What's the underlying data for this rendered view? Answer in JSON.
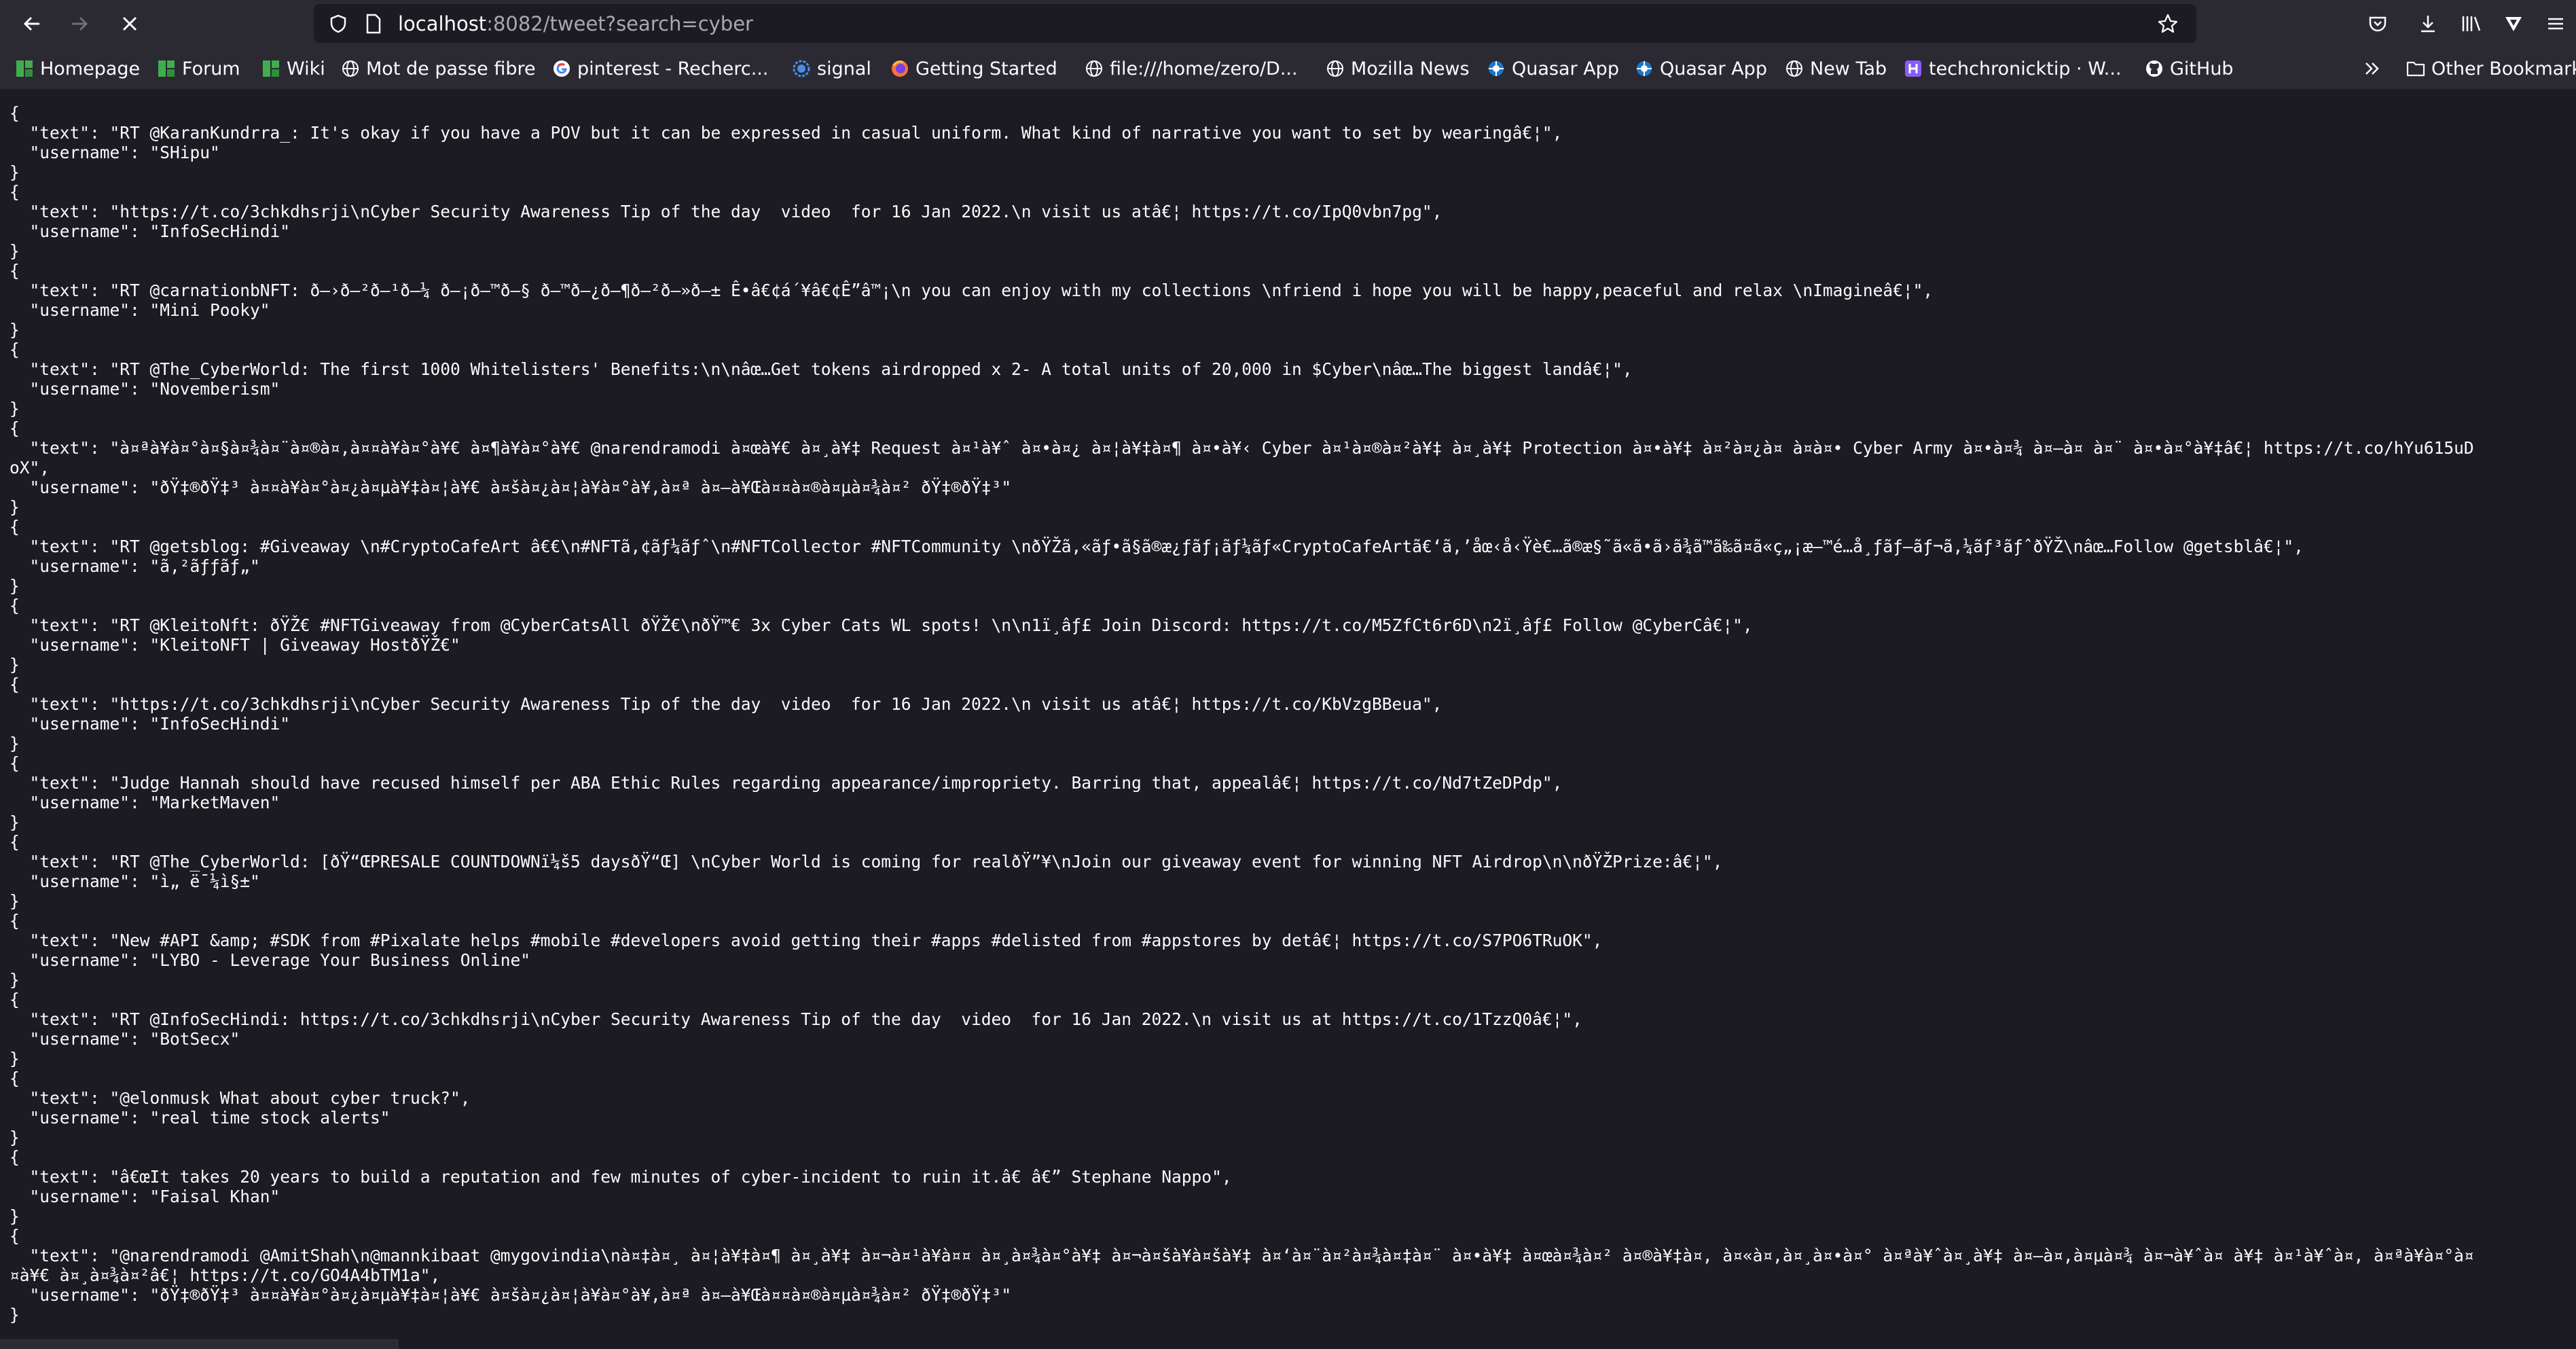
{
  "url": {
    "host": "localhost",
    "rest": ":8082/tweet?search=cyber"
  },
  "bookmarks": [
    {
      "label": "Homepage",
      "icon": "green-grid-icon"
    },
    {
      "label": "Forum",
      "icon": "green-grid-icon"
    },
    {
      "label": "Wiki",
      "icon": "green-grid-icon"
    },
    {
      "label": "Mot de passe fibre",
      "icon": "globe-icon"
    },
    {
      "label": "pinterest - Recherc...",
      "icon": "google-icon"
    },
    {
      "label": "signal",
      "icon": "signal-icon"
    },
    {
      "label": "Getting Started",
      "icon": "firefox-icon"
    },
    {
      "label": "file:///home/zero/D...",
      "icon": "globe-icon"
    },
    {
      "label": "Mozilla News",
      "icon": "globe-icon"
    },
    {
      "label": "Quasar App",
      "icon": "quasar-icon"
    },
    {
      "label": "Quasar App",
      "icon": "quasar-icon"
    },
    {
      "label": "New Tab",
      "icon": "globe-icon"
    },
    {
      "label": "techchronicktip · W...",
      "icon": "h-icon"
    },
    {
      "label": "GitHub",
      "icon": "github-icon"
    },
    {
      "label": "Other Bookmarks",
      "icon": "folder-icon"
    }
  ],
  "tweets": [
    {
      "text": "RT @KaranKundrra_: It's okay if you have a POV but it can be expressed in casual uniform. What kind of narrative you want to set by wearingâ€¦",
      "username": "SHipu"
    },
    {
      "text": "https://t.co/3chkdhsrji\\nCyber Security Awareness Tip of the day  video  for 16 Jan 2022.\\n visit us atâ€¦ https://t.co/IpQ0vbn7pg",
      "username": "InfoSecHindi"
    },
    {
      "text": "RT @carnationbNFT: ð–›ð–²ð–¹ð–¼ ð–¡ð–™ð–§ ð–™ð–¿ð–¶ð–²ð–»ð–± Ê•â€¢á´¥â€¢Ê”â™¡\\n you can enjoy with my collections \\nfriend i hope you will be happy,peaceful and relax \\nImagineâ€¦",
      "username": "Mini Pooky"
    },
    {
      "text": "RT @The_CyberWorld: The first 1000 Whitelisters' Benefits:\\n\\nâœ…Get tokens airdropped x 2- A total units of 20,000 in $Cyber\\nâœ…The biggest landâ€¦",
      "username": "Novemberism"
    },
    {
      "text": "à¤ªà¥à¤°à¤§à¤¾à¤¨à¤®à¤‚à¤¤à¥à¤°à¥€ à¤¶à¥à¤°à¥€ @narendramodi à¤œà¥€ à¤¸à¥‡ Request à¤¹à¥ˆ à¤•à¤¿ à¤¦à¥‡à¤¶ à¤•à¥‹ Cyber à¤¹à¤®à¤²à¥‡ à¤¸à¥‡ Protection à¤•à¥‡ à¤²à¤¿à¤ à¤à¤• Cyber Army à¤•à¤¾ à¤—à¤ à¤¨ à¤•à¤°à¥‡â€¦ https://t.co/hYu615uDoX",
      "username": "ðŸ‡®ðŸ‡³ à¤¤à¥à¤°à¤¿à¤µà¥‡à¤¦à¥€ à¤šà¤¿à¤¦à¥à¤°à¥‚à¤ª à¤—à¥Œà¤¤à¤®à¤µà¤¾à¤² ðŸ‡®ðŸ‡³"
    },
    {
      "text": "RT @getsblog: #Giveaway \\n#CryptoCafeArt â€€\\n#NFTã‚¢ãƒ¼ãƒˆ\\n#NFTCollector #NFTCommunity \\nðŸŽã‚«ãƒ•ã§ã®æ¿ƒãƒ¡ãƒ¼ãƒ«CryptoCafeArtã€‘ã‚’åœ‹å‹Ÿè€…ã®æ§˜ã«ã•ã›ã¾ã™ã‰ã¤ã«ç„¡æ–™é…å¸ƒãƒ—ãƒ¬ã‚¼ãƒ³ãƒˆðŸŽ\\nâœ…Follow @getsblâ€¦",
      "username": "ã‚²ãƒƒãƒ„"
    },
    {
      "text": "RT @KleitoNft: ðŸŽ€ #NFTGiveaway from @CyberCatsAll ðŸŽ€\\nðŸ™€ 3x Cyber Cats WL spots! \\n\\n1ï¸âƒ£ Join Discord: https://t.co/M5ZfCt6r6D\\n2ï¸âƒ£ Follow @CyberCâ€¦",
      "username": "KleitoNFT | Giveaway HostðŸŽ€"
    },
    {
      "text": "https://t.co/3chkdhsrji\\nCyber Security Awareness Tip of the day  video  for 16 Jan 2022.\\n visit us atâ€¦ https://t.co/KbVzgBBeua",
      "username": "InfoSecHindi"
    },
    {
      "text": "Judge Hannah should have recused himself per ABA Ethic Rules regarding appearance/impropriety. Barring that, appealâ€¦ https://t.co/Nd7tZeDPdp",
      "username": "MarketMaven"
    },
    {
      "text": "RT @The_CyberWorld: [ðŸ“ŒPRESALE COUNTDOWNï¼š5 daysðŸ“Œ] \\nCyber World is coming for realðŸ”¥\\nJoin our giveaway event for winning NFT Airdrop\\n\\nðŸŽPrize:â€¦",
      "username": "ì„ ë¯¼ì§±"
    },
    {
      "text": "New #API &amp; #SDK from #Pixalate helps #mobile #developers avoid getting their #apps #delisted from #appstores by detâ€¦ https://t.co/S7PO6TRuOK",
      "username": "LYBO - Leverage Your Business Online"
    },
    {
      "text": "RT @InfoSecHindi: https://t.co/3chkdhsrji\\nCyber Security Awareness Tip of the day  video  for 16 Jan 2022.\\n visit us at https://t.co/1TzzQ0â€¦",
      "username": "BotSecx"
    },
    {
      "text": "@elonmusk What about cyber truck?",
      "username": "real time stock alerts"
    },
    {
      "text": "â€œIt takes 20 years to build a reputation and few minutes of cyber-incident to ruin it.â€ â€” Stephane Nappo",
      "username": "Faisal Khan"
    },
    {
      "text": "@narendramodi @AmitShah\\n@mannkibaat @mygovindia\\nà¤‡à¤¸ à¤¦à¥‡à¤¶ à¤¸à¥‡ à¤¬à¤¹à¥à¤¤ à¤¸à¤¾à¤°à¥‡ à¤¬à¤šà¥à¤šà¥‡ à¤‘à¤¨à¤²à¤¾à¤‡à¤¨ à¤•à¥‡ à¤œà¤¾à¤² à¤®à¥‡à¤‚ à¤«à¤‚à¤¸à¤•à¤° à¤ªà¥ˆà¤¸à¥‡ à¤—à¤‚à¤µà¤¾ à¤¬à¥ˆà¤ à¥‡ à¤¹à¥ˆà¤‚ à¤ªà¥à¤°à¤¤à¥€ à¤¸à¤¾à¤²â€¦ https://t.co/GO4A4bTM1a",
      "username": "ðŸ‡®ðŸ‡³ à¤¤à¥à¤°à¤¿à¤µà¥‡à¤¦à¥€ à¤šà¤¿à¤¦à¥à¤°à¥‚à¤ª à¤—à¥Œà¤¤à¤®à¤µà¤¾à¤² ðŸ‡®ðŸ‡³"
    }
  ]
}
